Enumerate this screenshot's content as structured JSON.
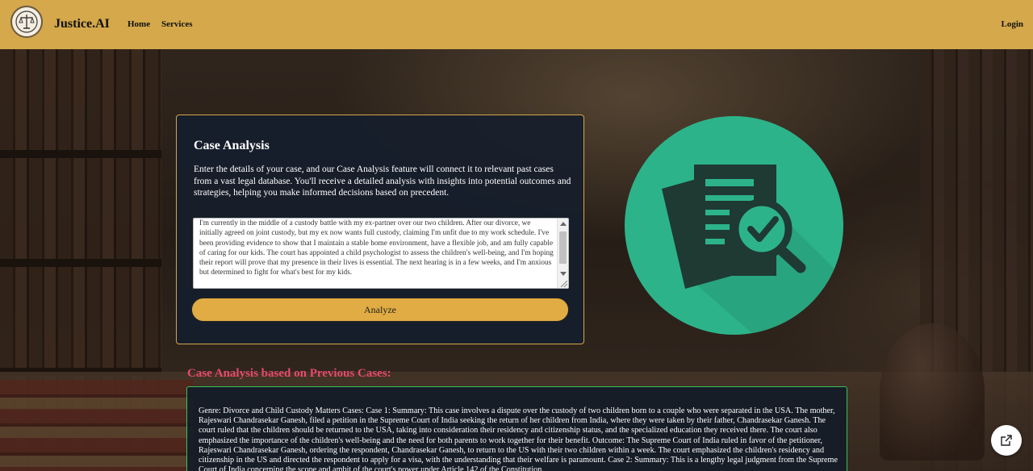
{
  "header": {
    "brand": "Justice.AI",
    "nav": [
      "Home",
      "Services"
    ],
    "login_label": "Login",
    "background_color": "#d4a84b"
  },
  "case_analysis": {
    "title": "Case Analysis",
    "description": "Enter the details of your case, and our Case Analysis feature will connect it to relevant past cases from a vast legal database. You'll receive a detailed analysis with insights into potential outcomes and strategies, helping you make informed decisions based on precedent.",
    "input_value": "I'm currently in the middle of a custody battle with my ex-partner over our two children. After our divorce, we initially agreed on joint custody, but my ex now wants full custody, claiming I'm unfit due to my work schedule. I've been providing evidence to show that I maintain a stable home environment, have a flexible job, and am fully capable of caring for our kids. The court has appointed a child psychologist to assess the children's well-being, and I'm hoping their report will prove that my presence in their lives is essential. The next hearing is in a few weeks, and I'm anxious but determined to fight for what's best for my kids.",
    "analyze_label": "Analyze",
    "button_color": "#e0ac43"
  },
  "illustration": {
    "icon": "document-search-check-icon",
    "circle_color": "#2db38a"
  },
  "results": {
    "heading": "Case Analysis based on Previous Cases:",
    "heading_color": "#e84a6a",
    "text": "Genre: Divorce and Child Custody Matters Cases: Case 1: Summary: This case involves a dispute over the custody of two children born to a couple who were separated in the USA. The mother, Rajeswari Chandrasekar Ganesh, filed a petition in the Supreme Court of India seeking the return of her children from India, where they were taken by their father, Chandrasekar Ganesh. The court ruled that the children should be returned to the USA, taking into consideration their residency and citizenship status, and the specialized education they received there. The court also emphasized the importance of the children's well-being and the need for both parents to work together for their benefit. Outcome: The Supreme Court of India ruled in favor of the petitioner, Rajeswari Chandrasekar Ganesh, ordering the respondent, Chandrasekar Ganesh, to return to the US with their two children within a week. The court emphasized the children's residency and citizenship in the US and directed the respondent to apply for a visa, with the understanding that their welfare is paramount. Case 2: Summary: This is a lengthy legal judgment from the Supreme Court of India concerning the scope and ambit of the court's power under Article 142 of the Constitution.",
    "border_color": "#3bbf5a"
  },
  "fab": {
    "icon": "external-link-icon"
  }
}
